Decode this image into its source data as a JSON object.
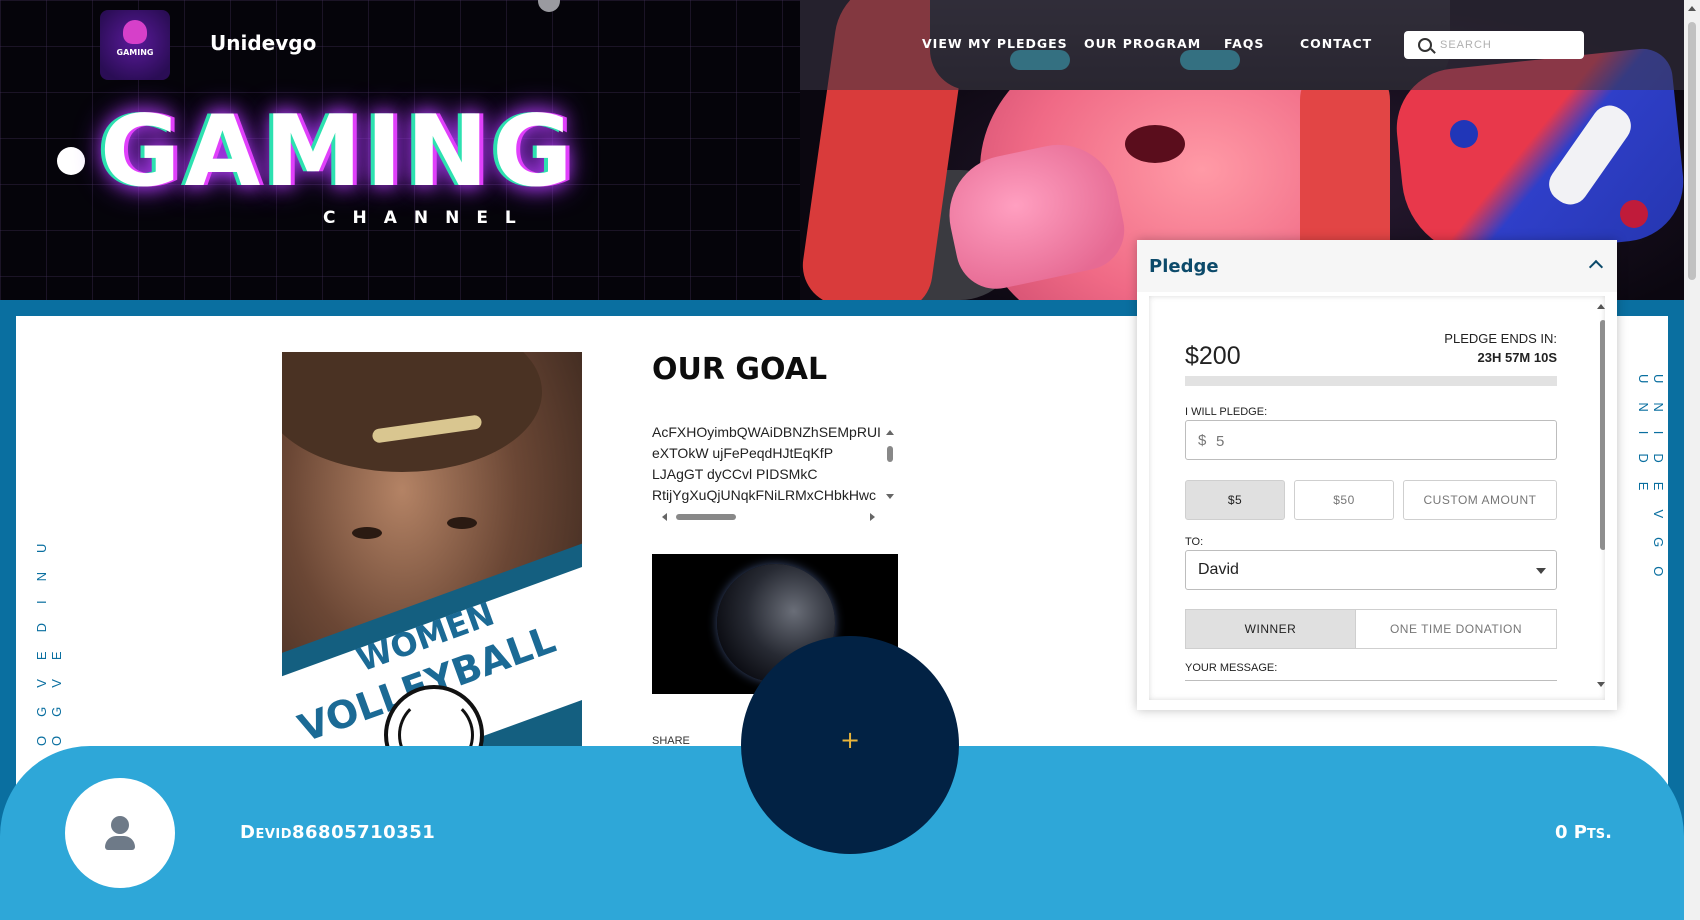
{
  "header": {
    "logo_text": "GAMING",
    "brand": "Unidevgo",
    "nav": [
      {
        "label": "VIEW MY PLEDGES"
      },
      {
        "label": "OUR PROGRAM"
      },
      {
        "label": "FAQS"
      },
      {
        "label": "CONTACT"
      }
    ],
    "search_placeholder": "SEARCH"
  },
  "hero": {
    "title": "GAMING",
    "subtitle": "CHANNEL"
  },
  "side_text": {
    "left": "OGVEDINU OGVE",
    "right": "UNIDEVGO UNIDE"
  },
  "poster": {
    "line1": "WOMEN",
    "line2": "VOLLEYBALL"
  },
  "goal": {
    "title": "OUR GOAL",
    "lines": [
      "AcFXHOyimbQWAiDBNZhSEMpRUI",
      "eXTOkW ujFePeqdHJtEqKfP",
      "LJAgGT dyCCvl PIDSMkC",
      "RtijYgXuQjUNqkFNiLRMxCHbkHwc"
    ],
    "share_label": "SHARE"
  },
  "pledge": {
    "title": "Pledge",
    "amount": "$200",
    "ends_label": "PLEDGE ENDS IN:",
    "ends_time": "23H 57M 10S",
    "progress_fraction": 0,
    "i_will_pledge_label": "I WILL PLEDGE:",
    "currency_symbol": "$",
    "input_value": "5",
    "buttons": {
      "b5": "$5",
      "b50": "$50",
      "custom": "CUSTOM AMOUNT"
    },
    "to_label": "TO:",
    "to_value": "David",
    "winner_label": "WINNER",
    "donation_label": "ONE TIME DONATION",
    "message_label": "YOUR MESSAGE:"
  },
  "footer": {
    "username": "Devid86805710351",
    "points": "0 Pts.",
    "fab_symbol": "+"
  },
  "colors": {
    "frame_blue": "#0a6fa0",
    "footer_blue": "#2ea7d8",
    "fab_navy": "#022244",
    "pledge_title": "#0c4a6a"
  }
}
